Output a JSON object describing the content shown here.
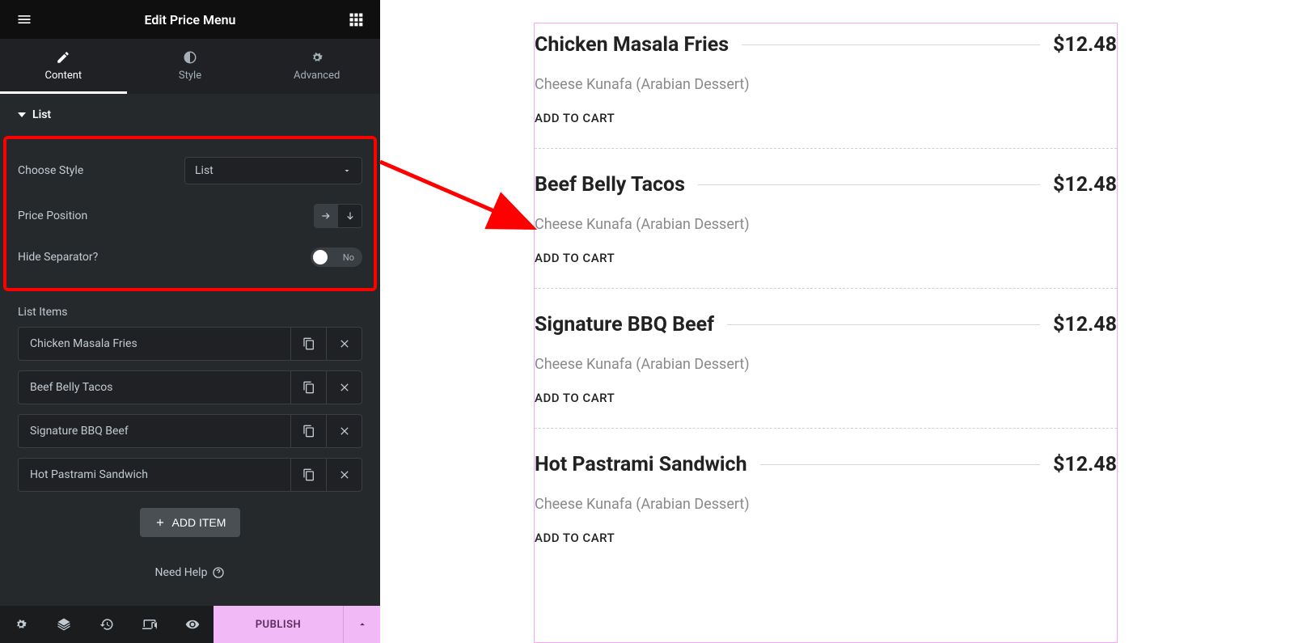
{
  "header": {
    "title": "Edit Price Menu"
  },
  "tabs": {
    "content": "Content",
    "style": "Style",
    "advanced": "Advanced"
  },
  "section": {
    "list": "List"
  },
  "controls": {
    "choose_style_label": "Choose Style",
    "choose_style_value": "List",
    "price_position_label": "Price Position",
    "hide_separator_label": "Hide Separator?",
    "hide_separator_value": "No"
  },
  "list_items_label": "List Items",
  "list_items": [
    {
      "name": "Chicken Masala Fries"
    },
    {
      "name": "Beef Belly Tacos"
    },
    {
      "name": "Signature BBQ Beef"
    },
    {
      "name": "Hot Pastrami Sandwich"
    }
  ],
  "add_item_label": "ADD ITEM",
  "need_help": "Need Help",
  "publish": "PUBLISH",
  "preview_items": [
    {
      "title": "Chicken Masala Fries",
      "price": "$12.48",
      "desc": "Cheese Kunafa (Arabian Dessert)",
      "cart": "ADD TO CART"
    },
    {
      "title": "Beef Belly Tacos",
      "price": "$12.48",
      "desc": "Cheese Kunafa (Arabian Dessert)",
      "cart": "ADD TO CART"
    },
    {
      "title": "Signature BBQ Beef",
      "price": "$12.48",
      "desc": "Cheese Kunafa (Arabian Dessert)",
      "cart": "ADD TO CART"
    },
    {
      "title": "Hot Pastrami Sandwich",
      "price": "$12.48",
      "desc": "Cheese Kunafa (Arabian Dessert)",
      "cart": "ADD TO CART"
    }
  ]
}
